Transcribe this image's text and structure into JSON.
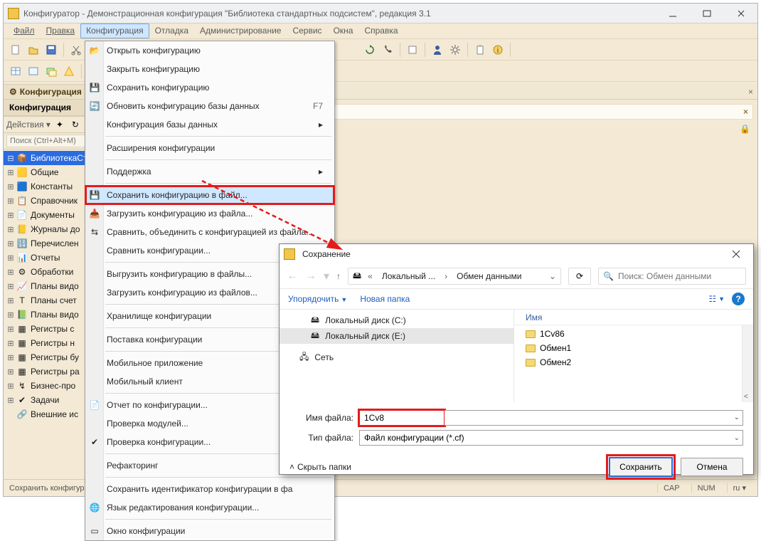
{
  "window": {
    "title": "Конфигуратор - Демонстрационная конфигурация \"Библиотека стандартных подсистем\", редакция 3.1"
  },
  "menubar": {
    "file": "Файл",
    "edit": "Правка",
    "config": "Конфигурация",
    "debug": "Отладка",
    "admin": "Администрирование",
    "service": "Сервис",
    "windows": "Окна",
    "help": "Справка"
  },
  "config_menu": {
    "open": "Открыть конфигурацию",
    "close": "Закрыть конфигурацию",
    "save": "Сохранить конфигурацию",
    "updatedb": "Обновить конфигурацию базы данных",
    "updatedb_accel": "F7",
    "dbconfig": "Конфигурация базы данных",
    "extensions": "Расширения конфигурации",
    "support": "Поддержка",
    "save_to_file": "Сохранить конфигурацию в файл...",
    "load_from_file": "Загрузить конфигурацию из файла...",
    "compare_merge": "Сравнить, объединить с конфигурацией из файла...",
    "compare": "Сравнить конфигурации...",
    "dump_files": "Выгрузить конфигурацию в файлы...",
    "load_files": "Загрузить конфигурацию из файлов...",
    "storage": "Хранилище конфигурации",
    "delivery": "Поставка конфигурации",
    "mobile_app": "Мобильное приложение",
    "mobile_client": "Мобильный клиент",
    "report": "Отчет по конфигурации...",
    "check_modules": "Проверка модулей...",
    "check_config": "Проверка конфигурации...",
    "refactoring": "Рефакторинг",
    "save_id": "Сохранить идентификатор конфигурации в фа",
    "lang": "Язык редактирования конфигурации...",
    "window": "Окно конфигурации"
  },
  "left_pane": {
    "tab": "Конфигурация",
    "heading": "Конфигурация",
    "actions": "Действия",
    "search_ph": "Поиск (Ctrl+Alt+M)",
    "tree": {
      "root": "БиблиотекаСтан",
      "common": "Общие",
      "constants": "Константы",
      "catalogs": "Справочник",
      "documents": "Документы",
      "journals": "Журналы до",
      "enums": "Перечислен",
      "reports": "Отчеты",
      "processings": "Обработки",
      "chart_char": "Планы видо",
      "chart_acc": "Планы счет",
      "chart_calc": "Планы видо",
      "info_regs": "Регистры с",
      "accum_regs": "Регистры н",
      "acc_regs": "Регистры бу",
      "calc_regs": "Регистры ра",
      "bp": "Бизнес-про",
      "tasks": "Задачи",
      "external": "Внешние ис"
    }
  },
  "dialog": {
    "title": "Сохранение",
    "breadcrumb1": "Локальный ...",
    "breadcrumb2": "Обмен данными",
    "search_ph": "Поиск: Обмен данными",
    "organize": "Упорядочить",
    "newfolder": "Новая папка",
    "left_items": {
      "c": "Локальный диск (C:)",
      "e": "Локальный диск (E:)",
      "net": "Сеть"
    },
    "col_name": "Имя",
    "files": {
      "f1": "1Cv86",
      "f2": "Обмен1",
      "f3": "Обмен2"
    },
    "filename_label": "Имя файла:",
    "filename_value": "1Cv8",
    "filetype_label": "Тип файла:",
    "filetype_value": "Файл конфигурации (*.cf)",
    "hide_folders": "Скрыть папки",
    "save_btn": "Сохранить",
    "cancel_btn": "Отмена"
  },
  "statusbar": {
    "hint": "Сохранить конфигурацию в файл",
    "cap": "CAP",
    "num": "NUM",
    "lang": "ru"
  }
}
